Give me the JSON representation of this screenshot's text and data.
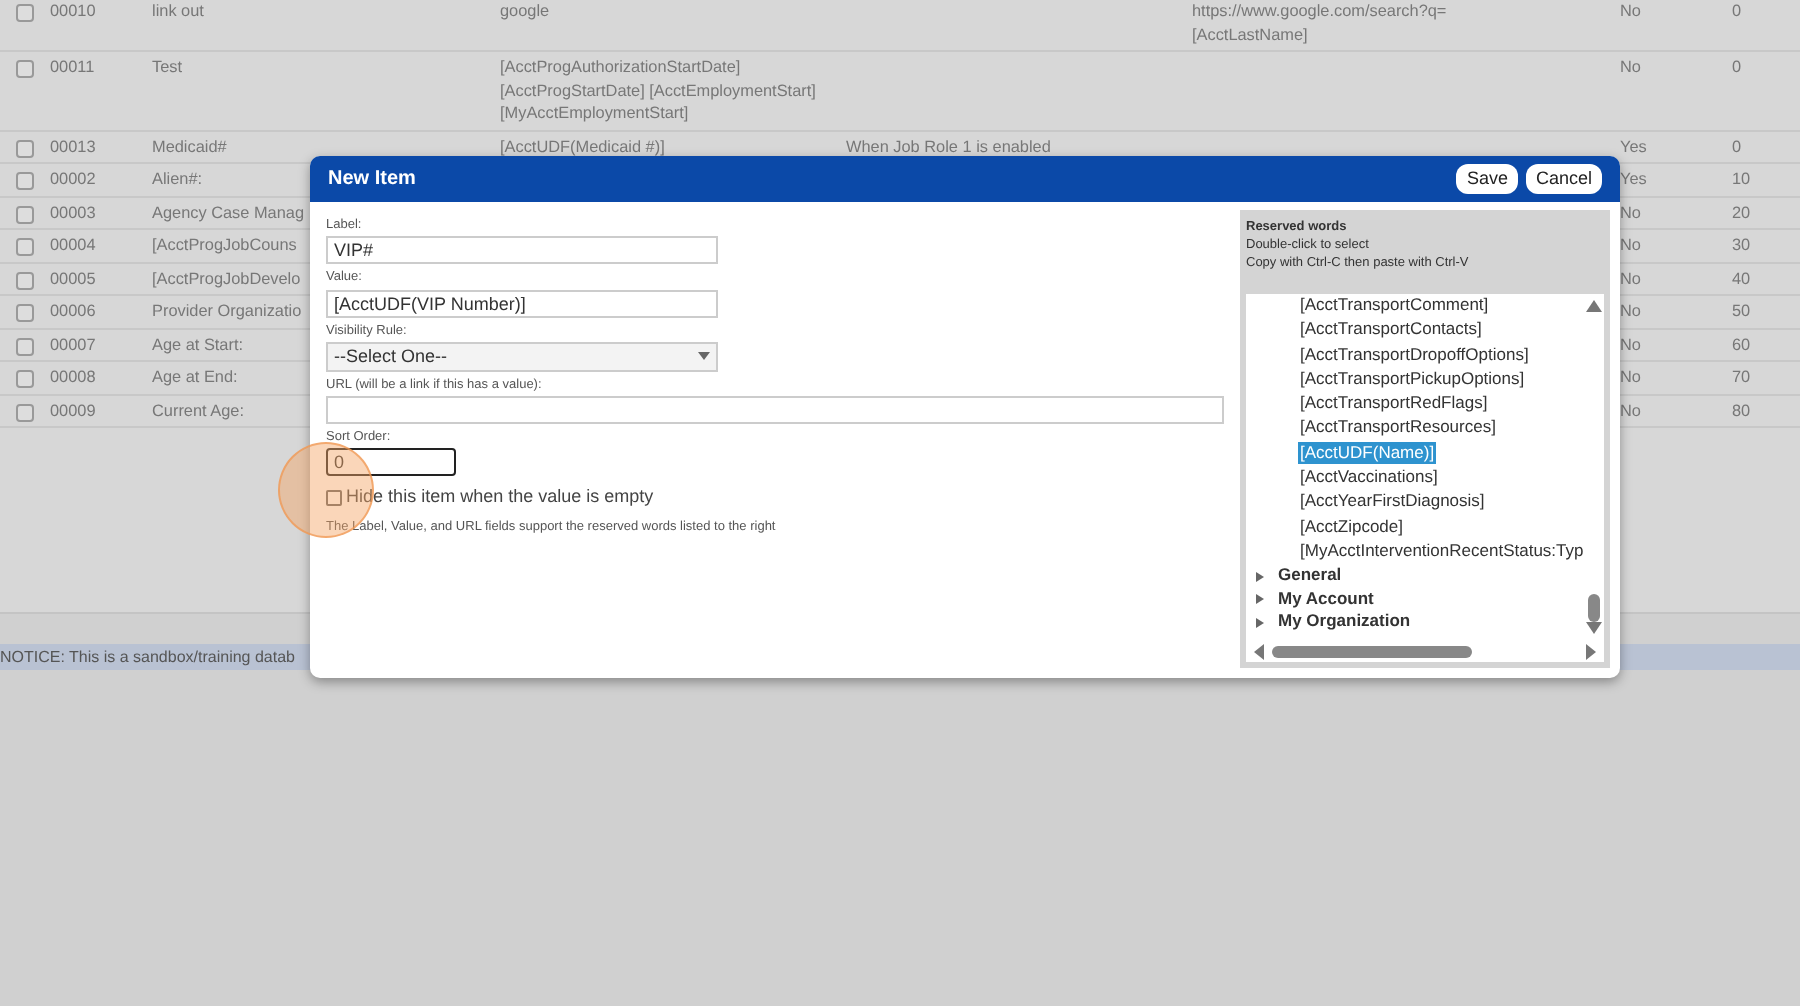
{
  "table": {
    "rows": [
      {
        "id": "00010",
        "name": "link out",
        "value": [
          "google"
        ],
        "rule": "",
        "url": [
          "https://www.google.com/search?q=",
          "[AcctLastName]"
        ],
        "hidden": "No",
        "sort": "0",
        "checked": false
      },
      {
        "id": "00011",
        "name": "Test",
        "value": [
          "[AcctProgAuthorizationStartDate]",
          "[AcctProgStartDate] [AcctEmploymentStart]",
          "[MyAcctEmploymentStart]"
        ],
        "rule": "",
        "url": [],
        "hidden": "No",
        "sort": "0",
        "checked": false
      },
      {
        "id": "00013",
        "name": "Medicaid#",
        "value": [
          "[AcctUDF(Medicaid #)]"
        ],
        "rule": "When Job Role 1 is enabled",
        "url": [],
        "hidden": "Yes",
        "sort": "0",
        "checked": false
      },
      {
        "id": "00002",
        "name": "Alien#:",
        "value": [],
        "rule": "",
        "url": [],
        "hidden": "Yes",
        "sort": "10",
        "checked": false
      },
      {
        "id": "00003",
        "name": "Agency Case Manag",
        "value": [],
        "rule": "",
        "url": [],
        "hidden": "No",
        "sort": "20",
        "checked": false
      },
      {
        "id": "00004",
        "name": "[AcctProgJobCouns",
        "value": [],
        "rule": "",
        "url": [],
        "hidden": "No",
        "sort": "30",
        "checked": false
      },
      {
        "id": "00005",
        "name": "[AcctProgJobDevelo",
        "value": [],
        "rule": "",
        "url": [],
        "hidden": "No",
        "sort": "40",
        "checked": false
      },
      {
        "id": "00006",
        "name": "Provider Organizatio",
        "value": [],
        "rule": "",
        "url": [],
        "hidden": "No",
        "sort": "50",
        "checked": false
      },
      {
        "id": "00007",
        "name": "Age at Start:",
        "value": [],
        "rule": "",
        "url": [],
        "hidden": "No",
        "sort": "60",
        "checked": false
      },
      {
        "id": "00008",
        "name": "Age at End:",
        "value": [],
        "rule": "",
        "url": [],
        "hidden": "No",
        "sort": "70",
        "checked": false
      },
      {
        "id": "00009",
        "name": "Current Age:",
        "value": [],
        "rule": "",
        "url": [],
        "hidden": "No",
        "sort": "80",
        "checked": false
      }
    ]
  },
  "notice": "NOTICE: This is a sandbox/training datab",
  "dialog": {
    "title": "New Item",
    "buttons": [
      "Save",
      "Cancel"
    ],
    "fields": [
      {
        "kind": "text",
        "label": "Label:",
        "value": "VIP#",
        "wide": false,
        "focused": false
      },
      {
        "kind": "text",
        "label": "Value:",
        "value": "[AcctUDF(VIP Number)]",
        "wide": false,
        "focused": false
      },
      {
        "kind": "select",
        "label": "Visibility Rule:",
        "value": "--Select One--",
        "wide": false,
        "focused": false
      },
      {
        "kind": "text",
        "label": "URL (will be a link if this has a value):",
        "wide": true,
        "focused": false
      },
      {
        "kind": "short",
        "label": "Sort Order:",
        "value": "0",
        "wide": false,
        "focused": true
      }
    ],
    "hide_checkbox": {
      "label": "Hide this item when the value is empty",
      "checked": false
    },
    "note": "The Label, Value, and URL fields support the reserved words listed to the right",
    "reserved_words": {
      "title": "Reserved words",
      "hints": [
        "Double-click to select",
        "Copy with Ctrl-C then paste with Ctrl-V"
      ],
      "items": [
        {
          "kind": "leaf",
          "label": "[AcctTransportComment]",
          "selected": false
        },
        {
          "kind": "leaf",
          "label": "[AcctTransportContacts]",
          "selected": false
        },
        {
          "kind": "leaf",
          "label": "[AcctTransportDropoffOptions]",
          "selected": false
        },
        {
          "kind": "leaf",
          "label": "[AcctTransportPickupOptions]",
          "selected": false
        },
        {
          "kind": "leaf",
          "label": "[AcctTransportRedFlags]",
          "selected": false
        },
        {
          "kind": "leaf",
          "label": "[AcctTransportResources]",
          "selected": false
        },
        {
          "kind": "leaf",
          "label": "[AcctUDF(Name)]",
          "selected": true
        },
        {
          "kind": "leaf",
          "label": "[AcctVaccinations]",
          "selected": false
        },
        {
          "kind": "leaf",
          "label": "[AcctYearFirstDiagnosis]",
          "selected": false
        },
        {
          "kind": "leaf",
          "label": "[AcctZipcode]",
          "selected": false
        },
        {
          "kind": "leaf",
          "label": "[MyAcctInterventionRecentStatus:Typ",
          "selected": false
        },
        {
          "kind": "group",
          "label": "General",
          "expanded": false
        },
        {
          "kind": "group",
          "label": "My Account",
          "expanded": false
        },
        {
          "kind": "group",
          "label": "My Organization",
          "expanded": false
        }
      ]
    }
  }
}
